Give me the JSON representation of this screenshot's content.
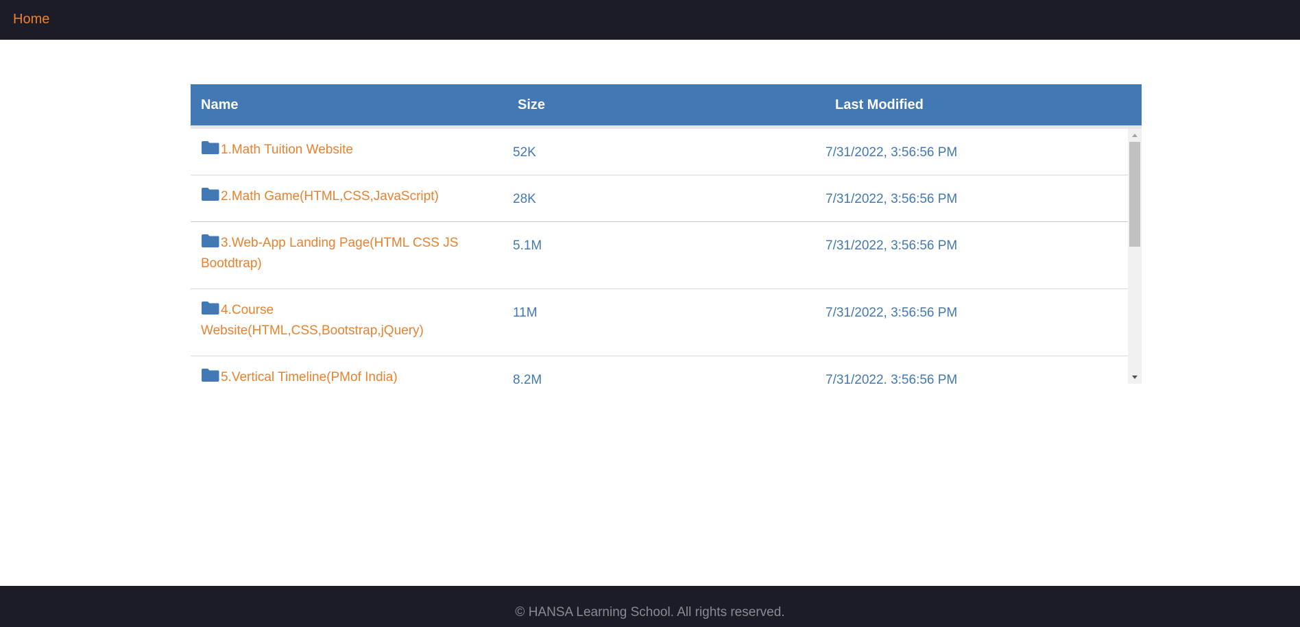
{
  "nav": {
    "home_label": "Home"
  },
  "table": {
    "columns": {
      "name": "Name",
      "size": "Size",
      "last_modified": "Last Modified"
    },
    "rows": [
      {
        "name": "1.Math Tuition Website",
        "size": "52K",
        "modified": "7/31/2022, 3:56:56 PM",
        "icon": "folder-icon"
      },
      {
        "name": "2.Math Game(HTML,CSS,JavaScript)",
        "size": "28K",
        "modified": "7/31/2022, 3:56:56 PM",
        "icon": "folder-icon"
      },
      {
        "name": "3.Web-App Landing Page(HTML CSS JS Bootdtrap)",
        "size": "5.1M",
        "modified": "7/31/2022, 3:56:56 PM",
        "icon": "folder-icon"
      },
      {
        "name": "4.Course Website(HTML,CSS,Bootstrap,jQuery)",
        "size": "11M",
        "modified": "7/31/2022, 3:56:56 PM",
        "icon": "folder-icon"
      },
      {
        "name": "5.Vertical Timeline(PMof India)",
        "size": "8.2M",
        "modified": "7/31/2022, 3:56:56 PM",
        "icon": "folder-icon"
      }
    ]
  },
  "footer": {
    "text": "© HANSA Learning School. All rights reserved."
  },
  "colors": {
    "header_bg": "#1c1c28",
    "accent_orange": "#e8822e",
    "table_header_blue": "#4278b4"
  }
}
